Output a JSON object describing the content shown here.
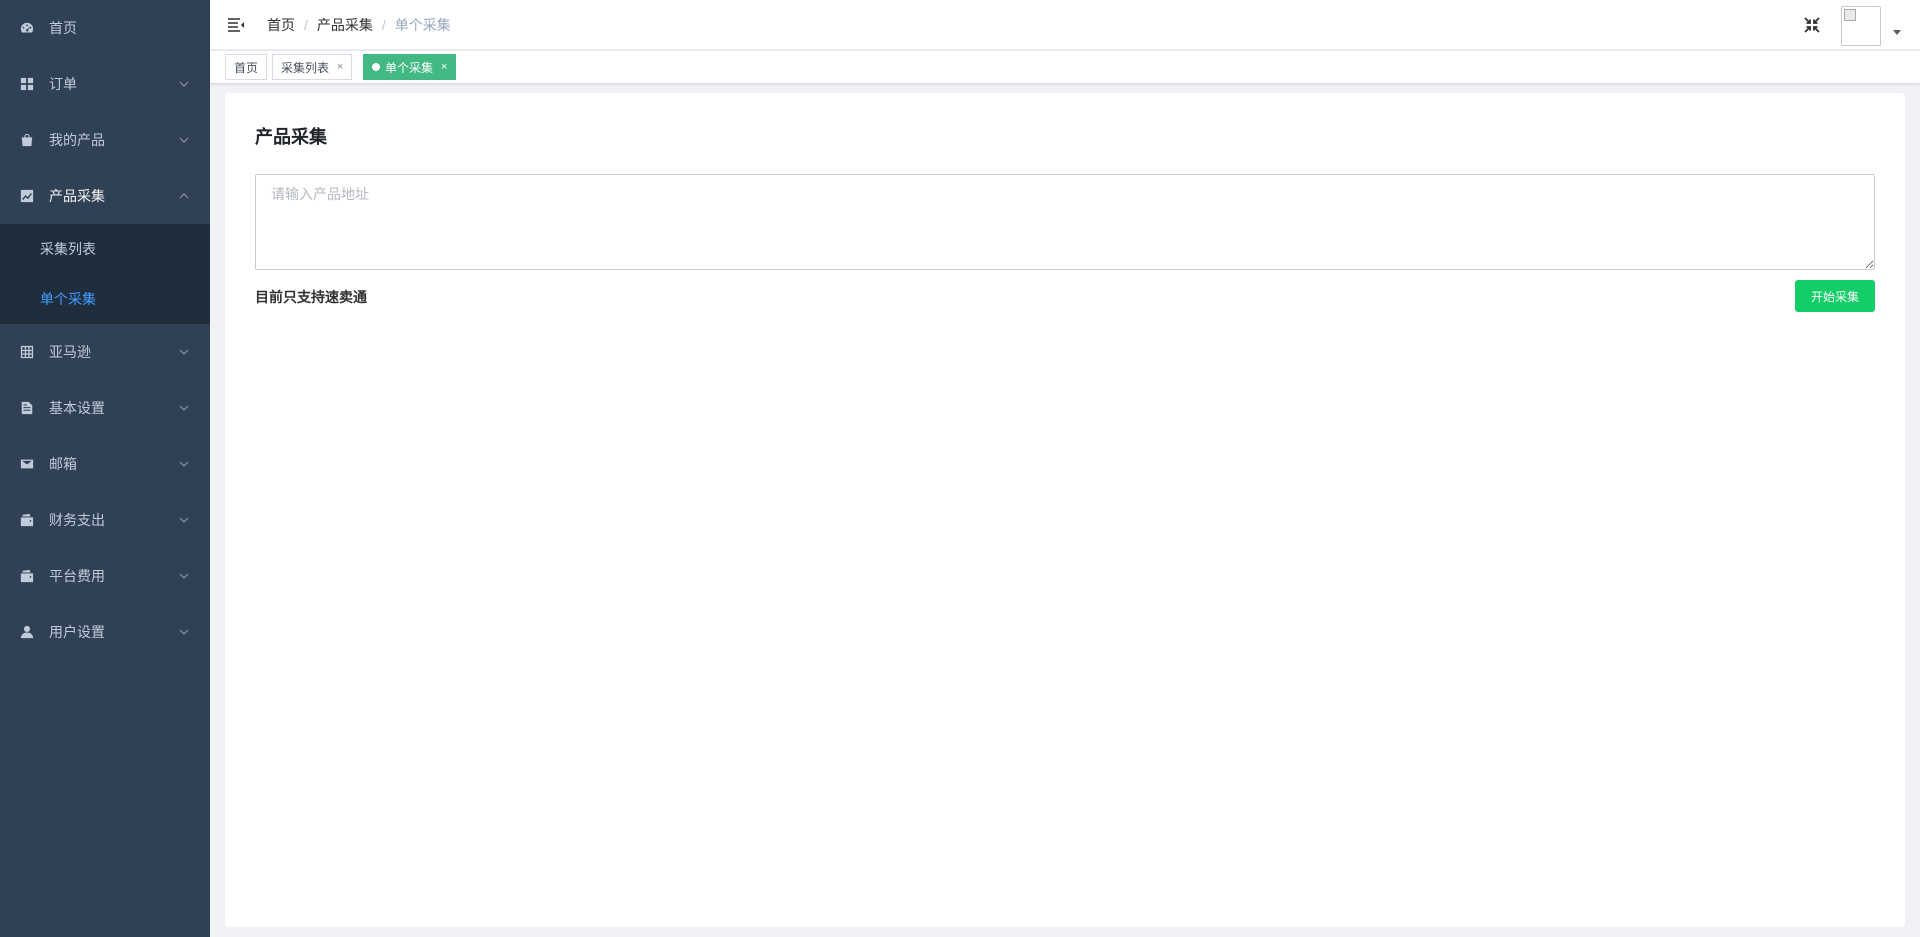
{
  "sidebar": {
    "items": [
      {
        "label": "首页",
        "icon": "dashboard-icon"
      },
      {
        "label": "订单",
        "icon": "grid-icon"
      },
      {
        "label": "我的产品",
        "icon": "shopping-bag-icon"
      },
      {
        "label": "产品采集",
        "icon": "chart-icon",
        "expanded": true,
        "children": [
          {
            "label": "采集列表"
          },
          {
            "label": "单个采集",
            "active": true
          }
        ]
      },
      {
        "label": "亚马逊",
        "icon": "table-icon"
      },
      {
        "label": "基本设置",
        "icon": "document-icon"
      },
      {
        "label": "邮箱",
        "icon": "mail-icon"
      },
      {
        "label": "财务支出",
        "icon": "wallet-icon"
      },
      {
        "label": "平台费用",
        "icon": "wallet-icon"
      },
      {
        "label": "用户设置",
        "icon": "user-icon"
      }
    ]
  },
  "navbar": {
    "breadcrumb": [
      "首页",
      "产品采集",
      "单个采集"
    ],
    "breadcrumb_separator": "/"
  },
  "tags": [
    {
      "label": "首页",
      "closable": false,
      "active": false
    },
    {
      "label": "采集列表",
      "closable": true,
      "active": false
    },
    {
      "label": "单个采集",
      "closable": true,
      "active": true
    }
  ],
  "tag_close": "×",
  "main": {
    "title": "产品采集",
    "input_placeholder": "请输入产品地址",
    "input_value": "",
    "support_note": "目前只支持速卖通",
    "start_button": "开始采集"
  },
  "colors": {
    "sidebar_bg": "#304156",
    "submenu_bg": "#1f2d3d",
    "active_link": "#409eff",
    "active_tag": "#42b983",
    "start_button": "#13ce66"
  }
}
